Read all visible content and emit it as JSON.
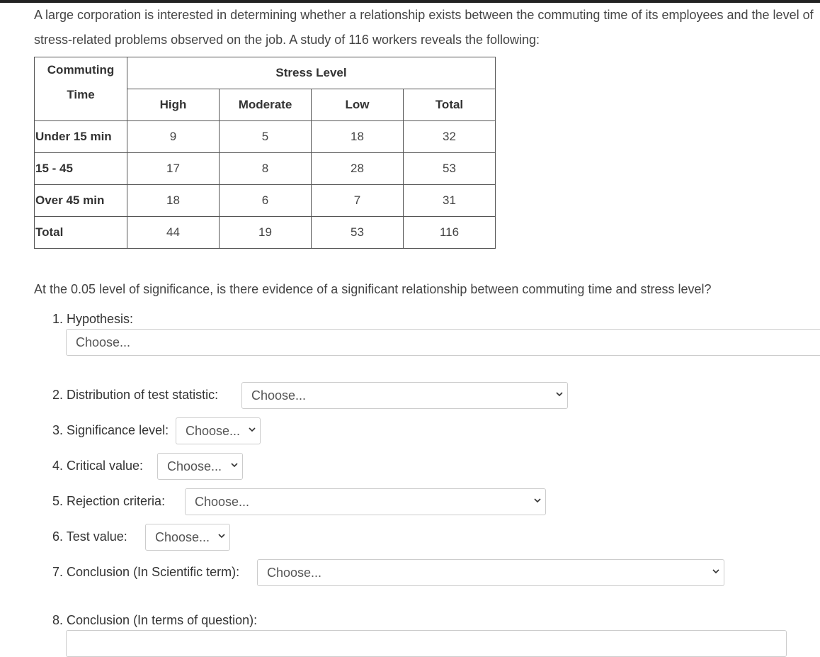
{
  "intro": "A large corporation is interested in determining whether a relationship exists between the commuting time of its employees and the level of stress-related problems observed on the job. A study of 116 workers reveals the following:",
  "table": {
    "corner_line1": "Commuting",
    "corner_line2": "Time",
    "group_header": "Stress Level",
    "columns": [
      "High",
      "Moderate",
      "Low",
      "Total"
    ],
    "rows": [
      {
        "label": "Under 15 min",
        "values": [
          "9",
          "5",
          "18",
          "32"
        ]
      },
      {
        "label": "15 - 45",
        "values": [
          "17",
          "8",
          "28",
          "53"
        ]
      },
      {
        "label": "Over 45 min",
        "values": [
          "18",
          "6",
          "7",
          "31"
        ]
      },
      {
        "label": "Total",
        "values": [
          "44",
          "19",
          "53",
          "116"
        ]
      }
    ]
  },
  "question": "At the 0.05 level of significance, is there evidence of a significant relationship between commuting time and stress level?",
  "items": [
    {
      "label": "1. Hypothesis:",
      "select": "Choose..."
    },
    {
      "label": "2. Distribution of test statistic:",
      "select": "Choose..."
    },
    {
      "label": "3. Significance level:",
      "select": "Choose..."
    },
    {
      "label": "4. Critical value:",
      "select": "Choose..."
    },
    {
      "label": "5. Rejection criteria:",
      "select": "Choose..."
    },
    {
      "label": "6. Test value:",
      "select": "Choose..."
    },
    {
      "label": "7. Conclusion (In Scientific term):",
      "select": "Choose..."
    },
    {
      "label": "8. Conclusion (In terms of question):",
      "select": ""
    }
  ]
}
